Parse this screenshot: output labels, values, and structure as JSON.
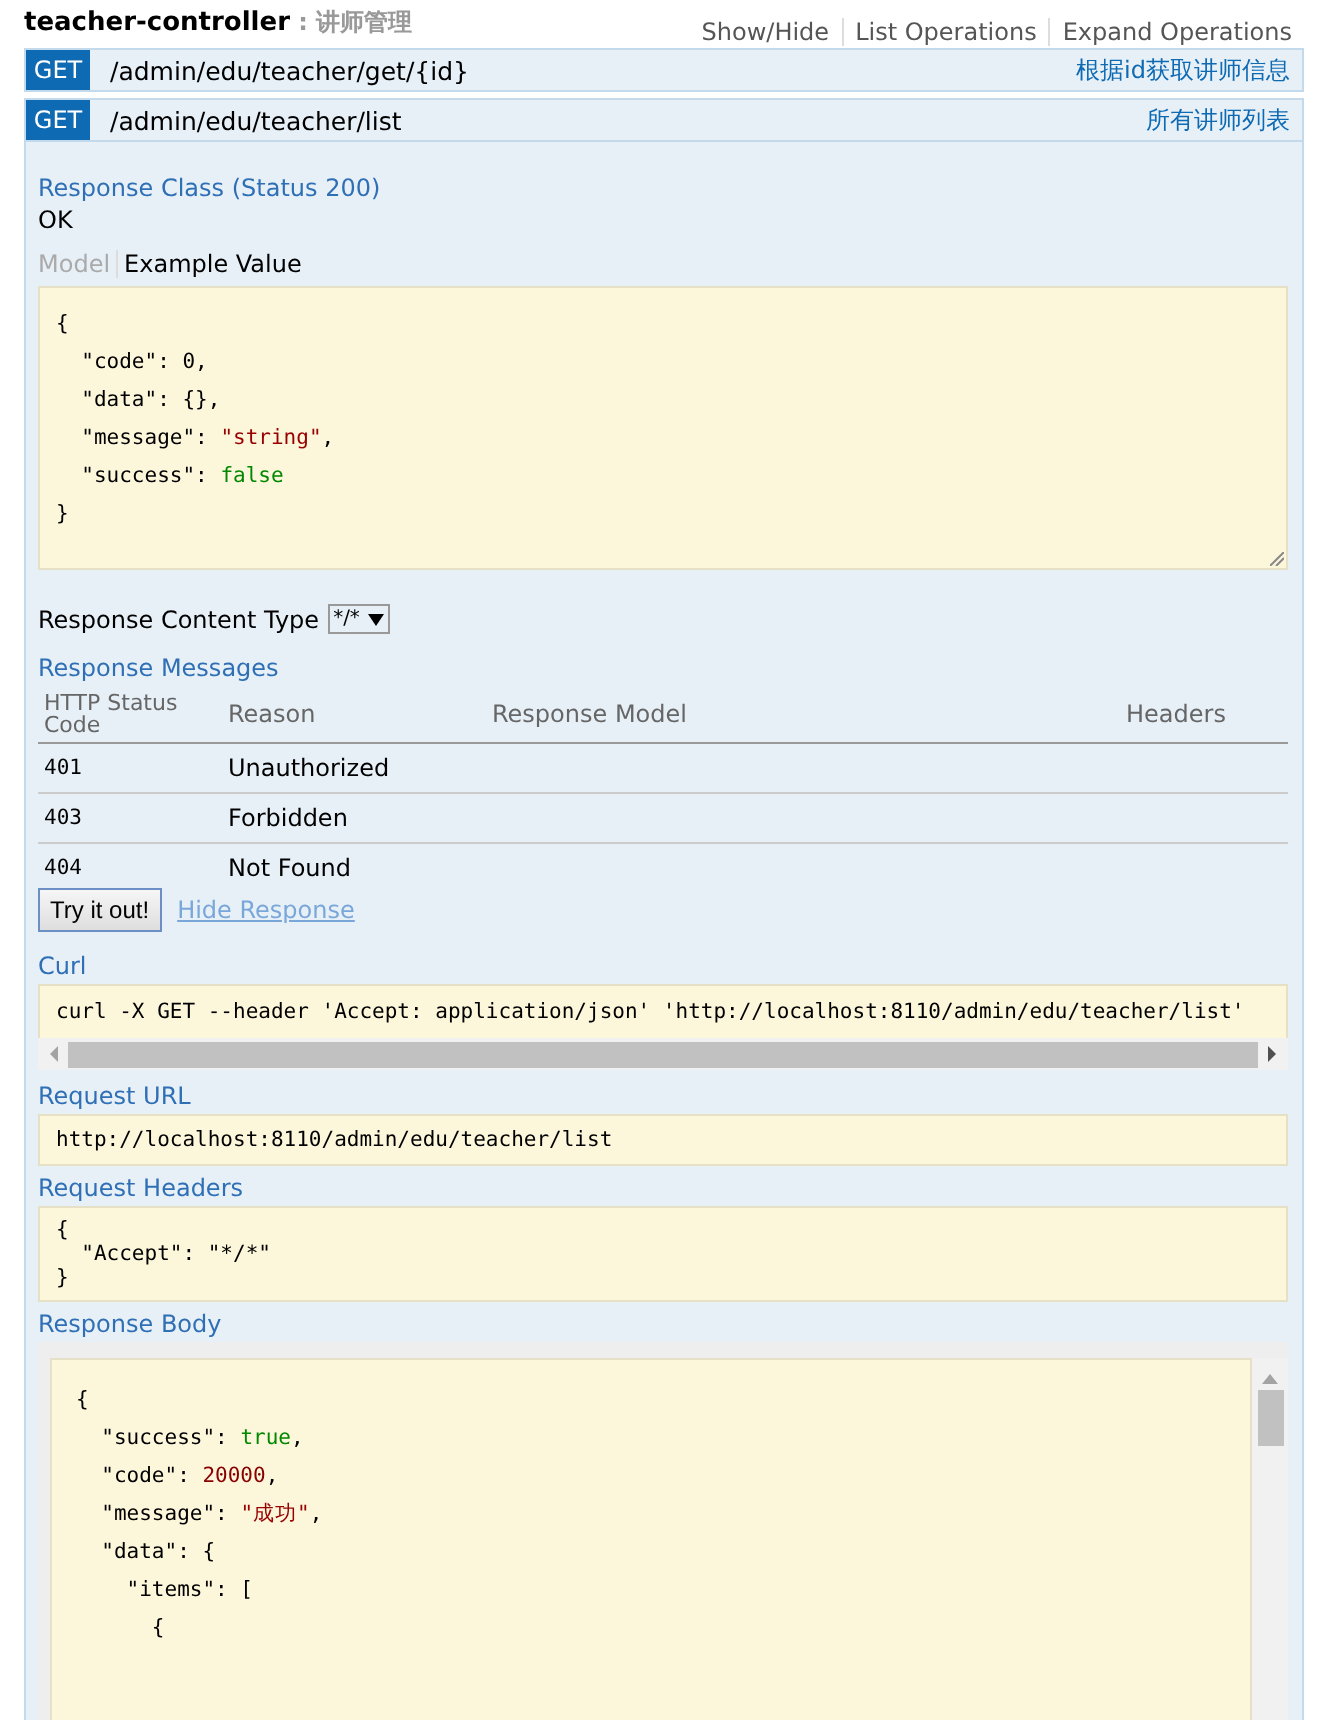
{
  "controller": {
    "name": "teacher-controller",
    "separator": " : ",
    "description": "讲师管理",
    "actions": [
      "Show/Hide",
      "List Operations",
      "Expand Operations"
    ]
  },
  "operations": [
    {
      "method": "GET",
      "path": "/admin/edu/teacher/get/{id}",
      "summary": "根据id获取讲师信息",
      "expanded": false
    },
    {
      "method": "GET",
      "path": "/admin/edu/teacher/list",
      "summary": "所有讲师列表",
      "expanded": true
    }
  ],
  "detail": {
    "response_class_title": "Response Class (Status 200)",
    "response_class_value": "OK",
    "model_tabs": [
      {
        "label": "Model",
        "selected": false
      },
      {
        "label": "Example Value",
        "selected": true
      }
    ],
    "example_value": [
      [
        {
          "text": "{",
          "kind": "text"
        }
      ],
      [
        {
          "text": "  \"code\": ",
          "kind": "text"
        },
        {
          "text": "0",
          "kind": "text"
        },
        {
          "text": ",",
          "kind": "text"
        }
      ],
      [
        {
          "text": "  \"data\": {},",
          "kind": "text"
        }
      ],
      [
        {
          "text": "  \"message\": ",
          "kind": "text"
        },
        {
          "text": "\"string\"",
          "kind": "string"
        },
        {
          "text": ",",
          "kind": "text"
        }
      ],
      [
        {
          "text": "  \"success\": ",
          "kind": "text"
        },
        {
          "text": "false",
          "kind": "literal"
        }
      ],
      [
        {
          "text": "}",
          "kind": "text"
        }
      ]
    ],
    "content_type_label": "Response Content Type",
    "content_type_value": "*/*",
    "messages_title": "Response Messages",
    "messages_columns": [
      "HTTP Status Code",
      "Reason",
      "Response Model",
      "Headers"
    ],
    "messages_rows": [
      {
        "code": "401",
        "reason": "Unauthorized"
      },
      {
        "code": "403",
        "reason": "Forbidden"
      },
      {
        "code": "404",
        "reason": "Not Found"
      }
    ],
    "try_button": "Try it out!",
    "hide_link": "Hide Response",
    "curl_title": "Curl",
    "curl": "curl -X GET --header 'Accept: application/json' 'http://localhost:8110/admin/edu/teacher/list'",
    "request_url_title": "Request URL",
    "request_url": "http://localhost:8110/admin/edu/teacher/list",
    "request_headers_title": "Request Headers",
    "request_headers": [
      "{",
      "  \"Accept\": \"*/*\"",
      "}"
    ],
    "response_body_title": "Response Body",
    "response_body": [
      [
        {
          "text": "{",
          "kind": "text"
        }
      ],
      [
        {
          "text": "  \"success\": ",
          "kind": "text"
        },
        {
          "text": "true",
          "kind": "literal"
        },
        {
          "text": ",",
          "kind": "text"
        }
      ],
      [
        {
          "text": "  \"code\": ",
          "kind": "text"
        },
        {
          "text": "20000",
          "kind": "number"
        },
        {
          "text": ",",
          "kind": "text"
        }
      ],
      [
        {
          "text": "  \"message\": ",
          "kind": "text"
        },
        {
          "text": "\"成功\"",
          "kind": "string"
        },
        {
          "text": ",",
          "kind": "text"
        }
      ],
      [
        {
          "text": "  \"data\": {",
          "kind": "text"
        }
      ],
      [
        {
          "text": "    \"items\": [",
          "kind": "text"
        }
      ],
      [
        {
          "text": "      {",
          "kind": "text"
        }
      ]
    ]
  }
}
